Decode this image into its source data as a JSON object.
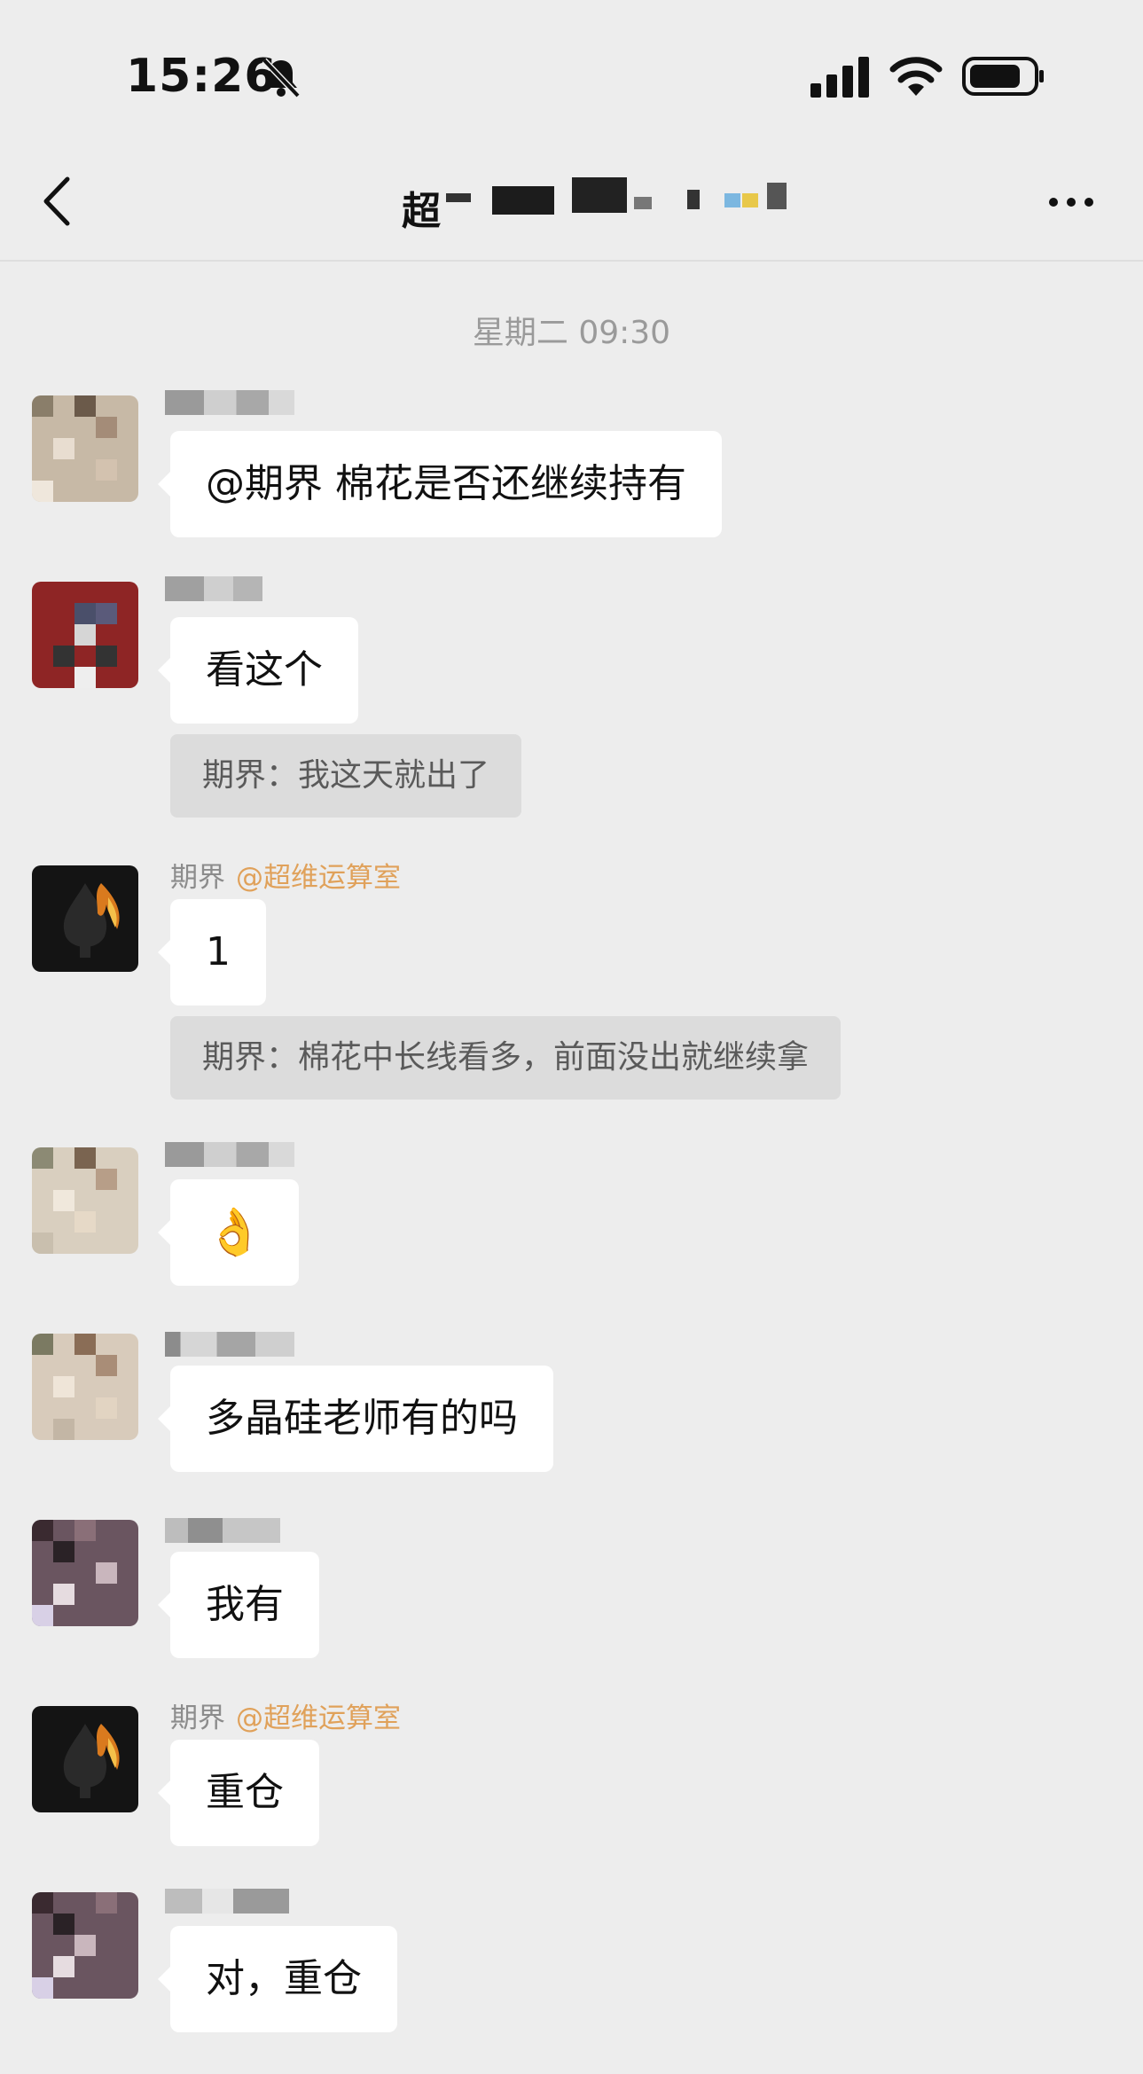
{
  "status_bar": {
    "time": "15:26"
  },
  "nav": {
    "title_visible": "超"
  },
  "timestamp": "星期二 09:30",
  "messages": [
    {
      "sender": "",
      "text": "@期界 棉花是否还继续持有"
    },
    {
      "sender": "",
      "text": "看这个",
      "quote": "期界：我这天就出了"
    },
    {
      "sender": "期界",
      "mention": "@超维运算室",
      "text": "1",
      "quote": "期界：棉花中长线看多，前面没出就继续拿"
    },
    {
      "sender": "",
      "text": "👌"
    },
    {
      "sender": "",
      "text": "多晶硅老师有的吗"
    },
    {
      "sender": "",
      "text": "我有"
    },
    {
      "sender": "期界",
      "mention": "@超维运算室",
      "text": "重仓"
    },
    {
      "sender": "",
      "text": "对，重仓"
    }
  ],
  "icons": {
    "back": "chevron-left-icon",
    "more": "more-horizontal-icon",
    "bell": "bell-slash-icon",
    "signal": "cellular-signal-icon",
    "wifi": "wifi-icon",
    "battery": "battery-icon"
  },
  "colors": {
    "background": "#ededed",
    "bubble": "#ffffff",
    "quote": "#dcdcdc",
    "mention": "#e0a15a"
  }
}
